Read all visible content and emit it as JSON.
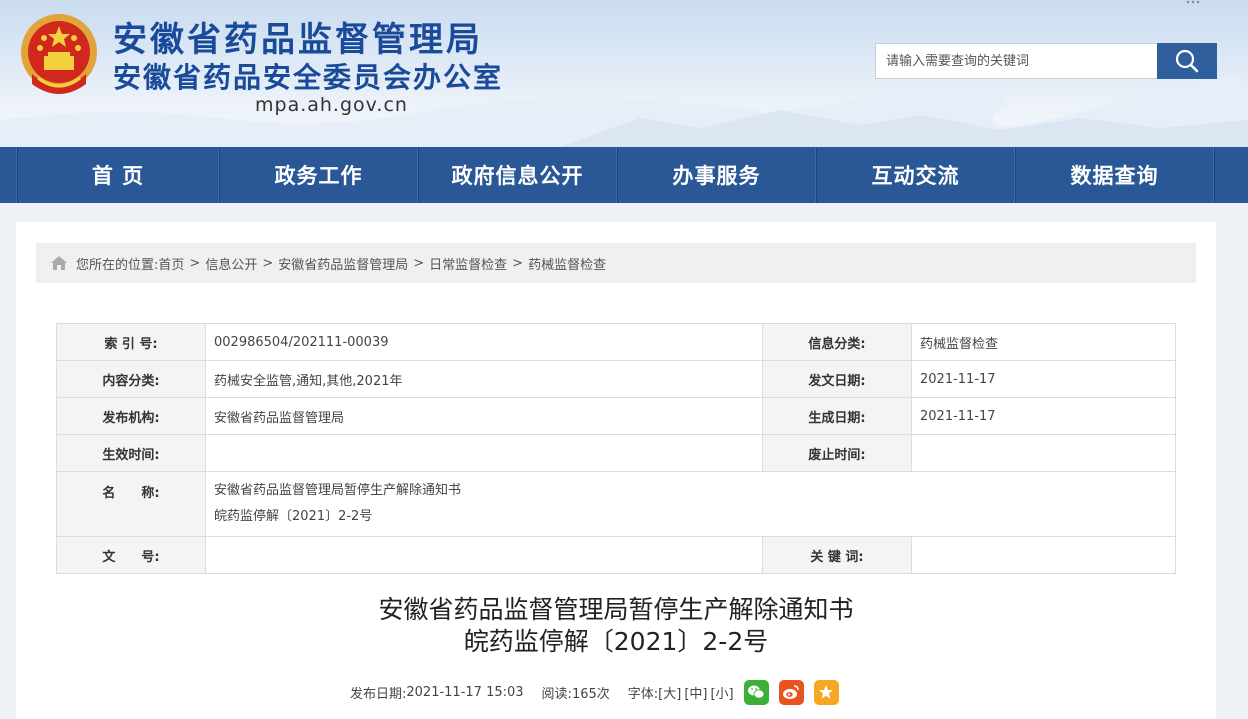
{
  "header": {
    "title_main": "安徽省药品监督管理局",
    "title_sub": "安徽省药品安全委员会办公室",
    "domain": "mpa.ah.gov.cn",
    "search_placeholder": "请输入需要查询的关键词"
  },
  "nav": {
    "items": [
      "首 页",
      "政务工作",
      "政府信息公开",
      "办事服务",
      "互动交流",
      "数据查询"
    ]
  },
  "breadcrumb": {
    "prefix": "您所在的位置:",
    "items": [
      "首页",
      "信息公开",
      "安徽省药品监督管理局",
      "日常监督检查",
      "药械监督检查"
    ],
    "separator": ">"
  },
  "info_table": {
    "index_label": "索 引 号:",
    "index_value": "002986504/202111-00039",
    "category_label": "信息分类:",
    "category_value": "药械监督检查",
    "content_cat_label": "内容分类:",
    "content_cat_value": "药械安全监管,通知,其他,2021年",
    "doc_date_label": "发文日期:",
    "doc_date_value": "2021-11-17",
    "publisher_label": "发布机构:",
    "publisher_value": "安徽省药品监督管理局",
    "gen_date_label": "生成日期:",
    "gen_date_value": "2021-11-17",
    "effective_label": "生效时间:",
    "effective_value": "",
    "abolish_label": "废止时间:",
    "abolish_value": "",
    "name_label": "名　　称:",
    "name_line1": "安徽省药品监督管理局暂停生产解除通知书",
    "name_line2": "皖药监停解〔2021〕2-2号",
    "docno_label": "文　　号:",
    "docno_value": "",
    "keywords_label": "关 键 词:",
    "keywords_value": ""
  },
  "article": {
    "title_line1": "安徽省药品监督管理局暂停生产解除通知书",
    "title_line2": "皖药监停解〔2021〕2-2号",
    "publish_label": "发布日期:",
    "publish_value": "2021-11-17 15:03",
    "reads_label": "阅读:",
    "reads_value": "165次",
    "font_label": "字体:",
    "font_large": "[大]",
    "font_medium": "[中]",
    "font_small": "[小]"
  },
  "share_icons": [
    "wechat-icon",
    "weibo-icon",
    "favorite-icon"
  ],
  "colors": {
    "nav_bg": "#2a5896",
    "title_blue": "#1a4a9a",
    "search_btn": "#2f5f9d",
    "wechat": "#3cb034",
    "weibo": "#e8541e",
    "favorite": "#f5a623"
  }
}
